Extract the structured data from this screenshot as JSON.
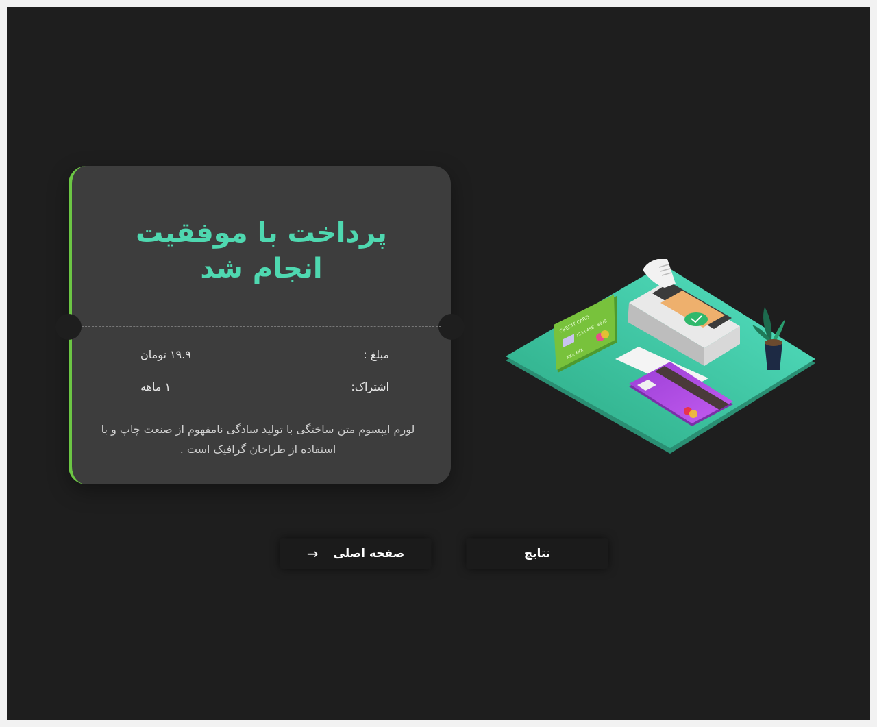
{
  "ticket": {
    "title_line1": "پرداخت  با موفقیت",
    "title_line2": "انجام شد",
    "amount_label": "مبلغ :",
    "amount_value": "۱۹.۹ تومان",
    "subscription_label": "اشتراک:",
    "subscription_value": "۱ ماهه",
    "description": "لورم ایپسوم متن ساختگی با تولید سادگی نامفهوم از صنعت چاپ و با استفاده از طراحان گرافیک است ."
  },
  "buttons": {
    "results_label": "نتایج",
    "home_label": "صفحه اصلی",
    "home_icon": "arrow-right-icon"
  },
  "illustration": {
    "card_green_title": "CREDIT CARD",
    "card_green_number": "1234 4567 8978",
    "card_green_holder": "XXX XXX",
    "colors": {
      "accent_teal": "#4fd8b0",
      "accent_green": "#6cc644",
      "card_purple": "#b44de0",
      "receipt_check": "#2fb86b"
    }
  }
}
